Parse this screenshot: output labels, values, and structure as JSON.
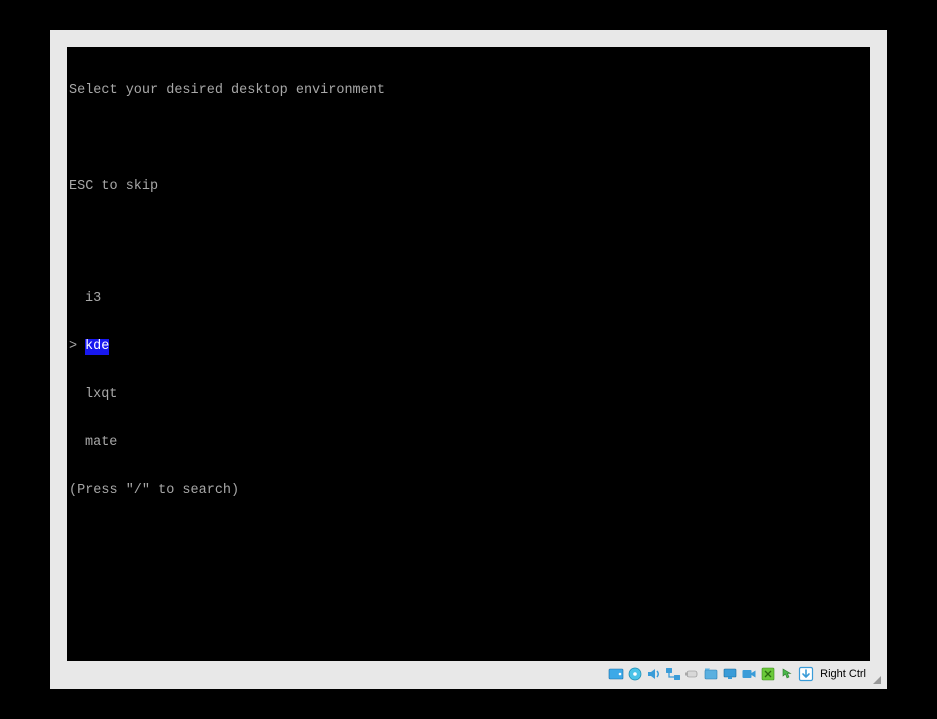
{
  "terminal": {
    "prompt": "Select your desired desktop environment",
    "skip_instruction": "ESC to skip",
    "pointer": ">",
    "items": [
      {
        "label": "i3",
        "selected": false
      },
      {
        "label": "kde",
        "selected": true
      },
      {
        "label": "lxqt",
        "selected": false
      },
      {
        "label": "mate",
        "selected": false
      }
    ],
    "search_hint": "(Press \"/\" to search)"
  },
  "statusbar": {
    "host_key": "Right Ctrl"
  }
}
